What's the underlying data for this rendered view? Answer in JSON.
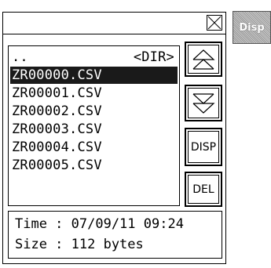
{
  "tab": {
    "label": "Disp"
  },
  "file_list": {
    "rows": [
      {
        "name": "..",
        "tag": "<DIR>"
      },
      {
        "name": "ZR00000.CSV",
        "tag": ""
      },
      {
        "name": "ZR00001.CSV",
        "tag": ""
      },
      {
        "name": "ZR00002.CSV",
        "tag": ""
      },
      {
        "name": "ZR00003.CSV",
        "tag": ""
      },
      {
        "name": "ZR00004.CSV",
        "tag": ""
      },
      {
        "name": "ZR00005.CSV",
        "tag": ""
      }
    ],
    "selected_index": 1
  },
  "buttons": {
    "scroll_up_icon": "double-chevron-up-icon",
    "scroll_down_icon": "double-chevron-down-icon",
    "disp_label": "DISP",
    "del_label": "DEL"
  },
  "info": {
    "time_line": "Time : 07/09/11 09:24",
    "size_line": "Size : 112 bytes"
  },
  "close_icon": "close-icon"
}
